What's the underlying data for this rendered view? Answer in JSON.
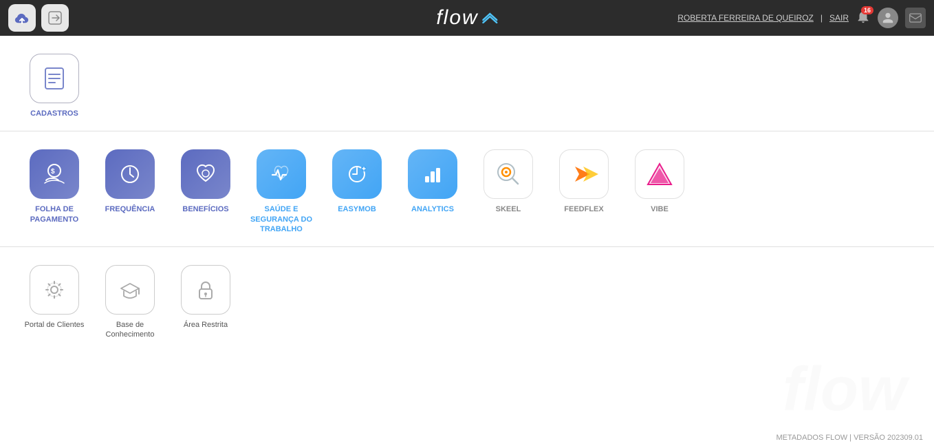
{
  "header": {
    "logo_text": "flow",
    "user_name": "ROBERTA FERREIRA DE QUEIROZ",
    "separator": "|",
    "sair_label": "SAIR",
    "notif_count": "16"
  },
  "section1": {
    "items": [
      {
        "id": "cadastros",
        "label": "CADASTROS",
        "icon_type": "cadastros",
        "color_class": "icon-cadastros"
      }
    ]
  },
  "section2": {
    "items": [
      {
        "id": "folha",
        "label": "FOLHA DE\nPAGAMENTO",
        "label_line1": "FOLHA DE",
        "label_line2": "PAGAMENTO",
        "icon_type": "folha",
        "color_class": "icon-blue-grad"
      },
      {
        "id": "frequencia",
        "label": "FREQUÊNCIA",
        "icon_type": "freq",
        "color_class": "icon-freq"
      },
      {
        "id": "beneficios",
        "label": "BENEFÍCIOS",
        "icon_type": "benef",
        "color_class": "icon-benef"
      },
      {
        "id": "saude",
        "label": "SAÚDE E\nSEGURANÇA DO\nTRABALHO",
        "label_line1": "SAÚDE E",
        "label_line2": "SEGURANÇA DO",
        "label_line3": "TRABALHO",
        "icon_type": "saude",
        "color_class": "icon-saude"
      },
      {
        "id": "easymob",
        "label": "EASYMOB",
        "icon_type": "easymob",
        "color_class": "icon-easymob"
      },
      {
        "id": "analytics",
        "label": "ANALYTICS",
        "icon_type": "analytics",
        "color_class": "icon-analytics"
      },
      {
        "id": "skeel",
        "label": "SKEEL",
        "icon_type": "skeel",
        "color_class": "icon-skeel"
      },
      {
        "id": "feedflex",
        "label": "FEEDFLEX",
        "icon_type": "feedflex",
        "color_class": "icon-feedflex"
      },
      {
        "id": "vibe",
        "label": "VIBE",
        "icon_type": "vibe",
        "color_class": "icon-vibe"
      }
    ]
  },
  "section3": {
    "items": [
      {
        "id": "portal",
        "label": "Portal de Clientes",
        "icon_type": "portal",
        "color_class": "icon-gray"
      },
      {
        "id": "base",
        "label": "Base de\nConhecimento",
        "label_line1": "Base de",
        "label_line2": "Conhecimento",
        "icon_type": "base",
        "color_class": "icon-gray"
      },
      {
        "id": "restrita",
        "label": "Área Restrita",
        "icon_type": "restrita",
        "color_class": "icon-gray"
      }
    ]
  },
  "footer": {
    "text": "METADADOS FLOW | VERSÃO 202309.01"
  }
}
